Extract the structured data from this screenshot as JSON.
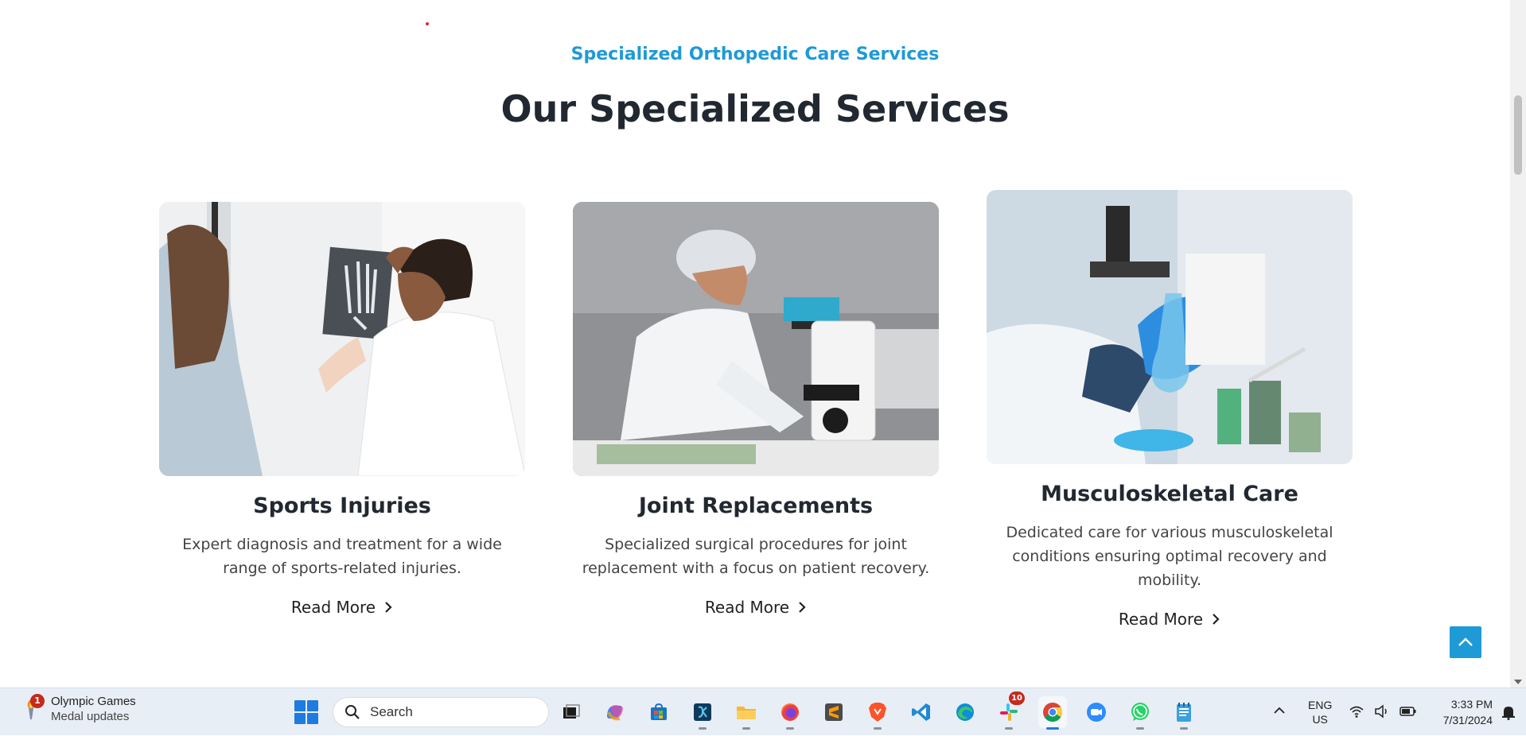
{
  "section": {
    "eyebrow": "Specialized Orthopedic Care Services",
    "heading": "Our Specialized Services"
  },
  "cards": [
    {
      "title": "Sports Injuries",
      "description": "Expert diagnosis and treatment for a wide range of sports-related injuries.",
      "cta": "Read More"
    },
    {
      "title": "Joint Replacements",
      "description": "Specialized surgical procedures for joint replacement with a focus on patient recovery.",
      "cta": "Read More"
    },
    {
      "title": "Musculoskeletal Care",
      "description": "Dedicated care for various musculoskeletal conditions ensuring optimal recovery and mobility.",
      "cta": "Read More"
    }
  ],
  "colors": {
    "accent": "#1e9ad6",
    "heading": "#222831",
    "text": "#444444"
  },
  "taskbar": {
    "widget": {
      "title": "Olympic Games",
      "subtitle": "Medal updates",
      "badge": "1",
      "icon": "torch-icon"
    },
    "search_placeholder": "Search",
    "apps": [
      {
        "name": "task-view-icon"
      },
      {
        "name": "copilot-icon"
      },
      {
        "name": "microsoft-store-icon"
      },
      {
        "name": "terminal-icon"
      },
      {
        "name": "file-explorer-icon"
      },
      {
        "name": "firefox-icon"
      },
      {
        "name": "sublime-text-icon"
      },
      {
        "name": "brave-icon"
      },
      {
        "name": "vscode-icon"
      },
      {
        "name": "edge-icon"
      },
      {
        "name": "slack-icon",
        "badge": "10"
      },
      {
        "name": "chrome-icon",
        "active": true
      },
      {
        "name": "zoom-icon"
      },
      {
        "name": "whatsapp-icon"
      },
      {
        "name": "notepad-icon"
      }
    ],
    "tray": {
      "lang_line1": "ENG",
      "lang_line2": "US",
      "time": "3:33 PM",
      "date": "7/31/2024"
    }
  }
}
